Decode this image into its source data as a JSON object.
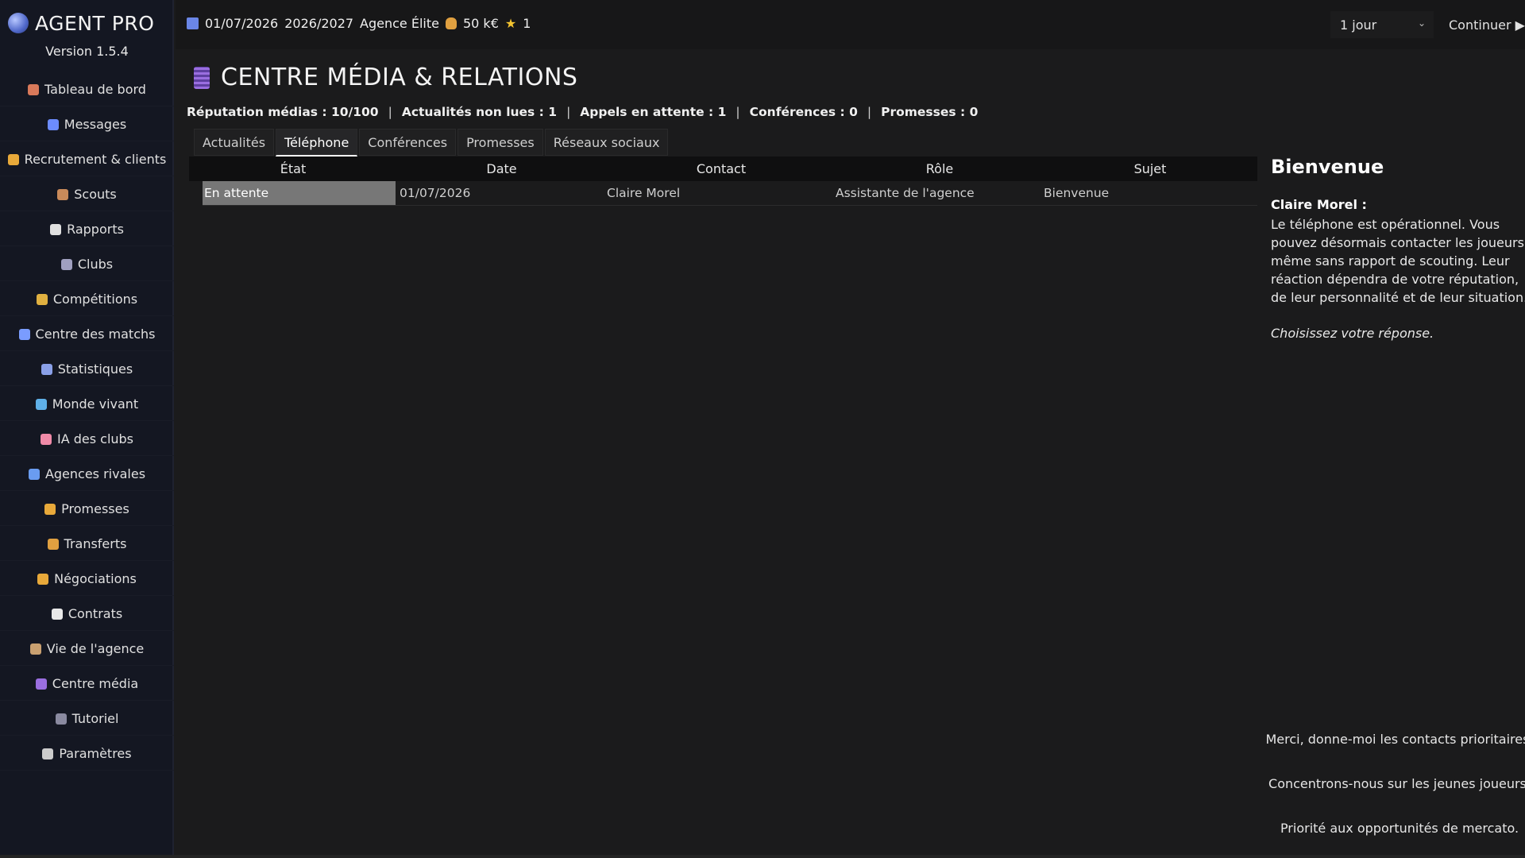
{
  "app": {
    "title": "AGENT PRO",
    "version": "Version 1.5.4"
  },
  "sidebar": {
    "items": [
      {
        "label": "Tableau de bord",
        "icon": "home-icon",
        "color": "#d9795a"
      },
      {
        "label": "Messages",
        "icon": "mailbox-icon",
        "color": "#6c8cff"
      },
      {
        "label": "Recrutement & clients",
        "icon": "handshake-icon",
        "color": "#e8a93a"
      },
      {
        "label": "Scouts",
        "icon": "scout-icon",
        "color": "#c98a5a"
      },
      {
        "label": "Rapports",
        "icon": "report-icon",
        "color": "#e0e0e0"
      },
      {
        "label": "Clubs",
        "icon": "stadium-icon",
        "color": "#a0a0c0"
      },
      {
        "label": "Compétitions",
        "icon": "trophy-icon",
        "color": "#e0b040"
      },
      {
        "label": "Centre des matchs",
        "icon": "ball-icon",
        "color": "#7a9cff"
      },
      {
        "label": "Statistiques",
        "icon": "chart-icon",
        "color": "#8aa0e8"
      },
      {
        "label": "Monde vivant",
        "icon": "globe-icon",
        "color": "#5fb0e8"
      },
      {
        "label": "IA des clubs",
        "icon": "brain-icon",
        "color": "#f08aa8"
      },
      {
        "label": "Agences rivales",
        "icon": "building-icon",
        "color": "#6a9cf0"
      },
      {
        "label": "Promesses",
        "icon": "handshake-icon",
        "color": "#e8a93a"
      },
      {
        "label": "Transferts",
        "icon": "money-bag-icon",
        "color": "#e0a040"
      },
      {
        "label": "Négociations",
        "icon": "handshake-icon",
        "color": "#e8a93a"
      },
      {
        "label": "Contrats",
        "icon": "document-icon",
        "color": "#e8e8e8"
      },
      {
        "label": "Vie de l'agence",
        "icon": "person-icon",
        "color": "#c9a070"
      },
      {
        "label": "Centre média",
        "icon": "phone-icon",
        "color": "#9a6ee0"
      },
      {
        "label": "Tutoriel",
        "icon": "graduation-icon",
        "color": "#8a8aa0"
      },
      {
        "label": "Paramètres",
        "icon": "gear-icon",
        "color": "#cccccc"
      }
    ]
  },
  "topbar": {
    "date": "01/07/2026",
    "season": "2026/2027",
    "agency": "Agence Élite",
    "money": "50 k€",
    "stars": "1",
    "speed_select": "1 jour",
    "continue_label": "Continuer ▶"
  },
  "page": {
    "title": "CENTRE MÉDIA & RELATIONS",
    "stats": [
      "Réputation médias : 10/100",
      "Actualités non lues : 1",
      "Appels en attente : 1",
      "Conférences : 0",
      "Promesses : 0"
    ],
    "tabs": [
      "Actualités",
      "Téléphone",
      "Conférences",
      "Promesses",
      "Réseaux sociaux"
    ],
    "active_tab": 1
  },
  "table": {
    "headers": [
      "État",
      "Date",
      "Contact",
      "Rôle",
      "Sujet"
    ],
    "rows": [
      {
        "state": "En attente",
        "date": "01/07/2026",
        "contact": "Claire Morel",
        "role": "Assistante de l'agence",
        "subject": "Bienvenue"
      }
    ]
  },
  "detail": {
    "title": "Bienvenue",
    "from": "Claire Morel :",
    "message": "Le téléphone est opérationnel. Vous pouvez désormais contacter les joueurs même sans rapport de scouting. Leur réaction dépendra de votre réputation, de leur personnalité et de leur situation.",
    "prompt": "Choisissez votre réponse.",
    "responses": [
      "Merci, donne-moi les contacts prioritaires.",
      "Concentrons-nous sur les jeunes joueurs.",
      "Priorité aux opportunités de mercato."
    ]
  }
}
